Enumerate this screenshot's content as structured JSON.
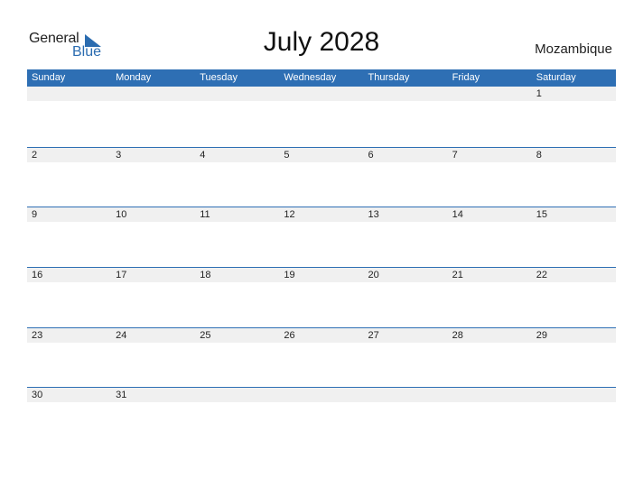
{
  "logo": {
    "word1": "General",
    "word2": "Blue",
    "icon": "triangle-flag-icon"
  },
  "title": "July 2028",
  "country": "Mozambique",
  "colors": {
    "header_bg": "#2e6fb4",
    "day_band": "#f0f0f0",
    "brand_blue": "#2b6cb0"
  },
  "weekdays": [
    "Sunday",
    "Monday",
    "Tuesday",
    "Wednesday",
    "Thursday",
    "Friday",
    "Saturday"
  ],
  "weeks": [
    [
      "",
      "",
      "",
      "",
      "",
      "",
      "1"
    ],
    [
      "2",
      "3",
      "4",
      "5",
      "6",
      "7",
      "8"
    ],
    [
      "9",
      "10",
      "11",
      "12",
      "13",
      "14",
      "15"
    ],
    [
      "16",
      "17",
      "18",
      "19",
      "20",
      "21",
      "22"
    ],
    [
      "23",
      "24",
      "25",
      "26",
      "27",
      "28",
      "29"
    ],
    [
      "30",
      "31",
      "",
      "",
      "",
      "",
      ""
    ]
  ]
}
